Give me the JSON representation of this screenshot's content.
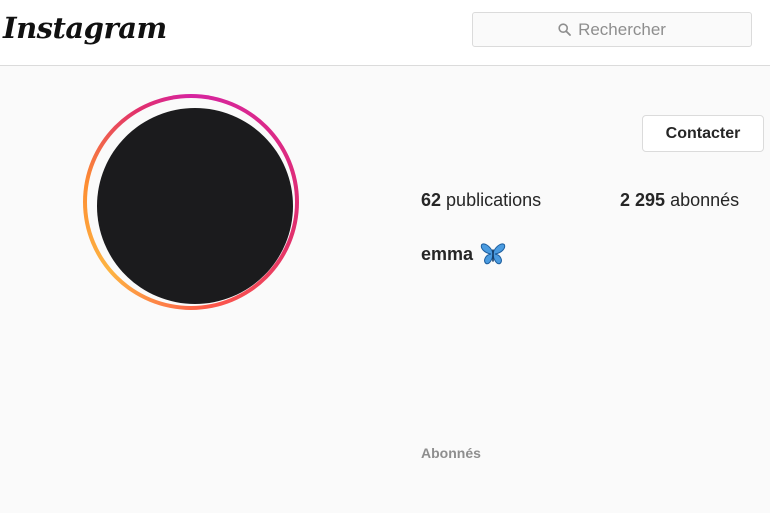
{
  "header": {
    "logo": "Instagram",
    "search": {
      "placeholder": "Rechercher",
      "icon": "search-icon"
    }
  },
  "profile": {
    "contact_label": "Contacter",
    "stats": {
      "posts_count": "62",
      "posts_label": "publications",
      "followers_count": "2 295",
      "followers_label": "abonnés"
    },
    "username": "emma",
    "username_emoji_icon": "butterfly-icon",
    "avatar_ring_colors": [
      "#d6249f",
      "#fd5949",
      "#fdb442"
    ]
  },
  "section_label": "Abonnés"
}
